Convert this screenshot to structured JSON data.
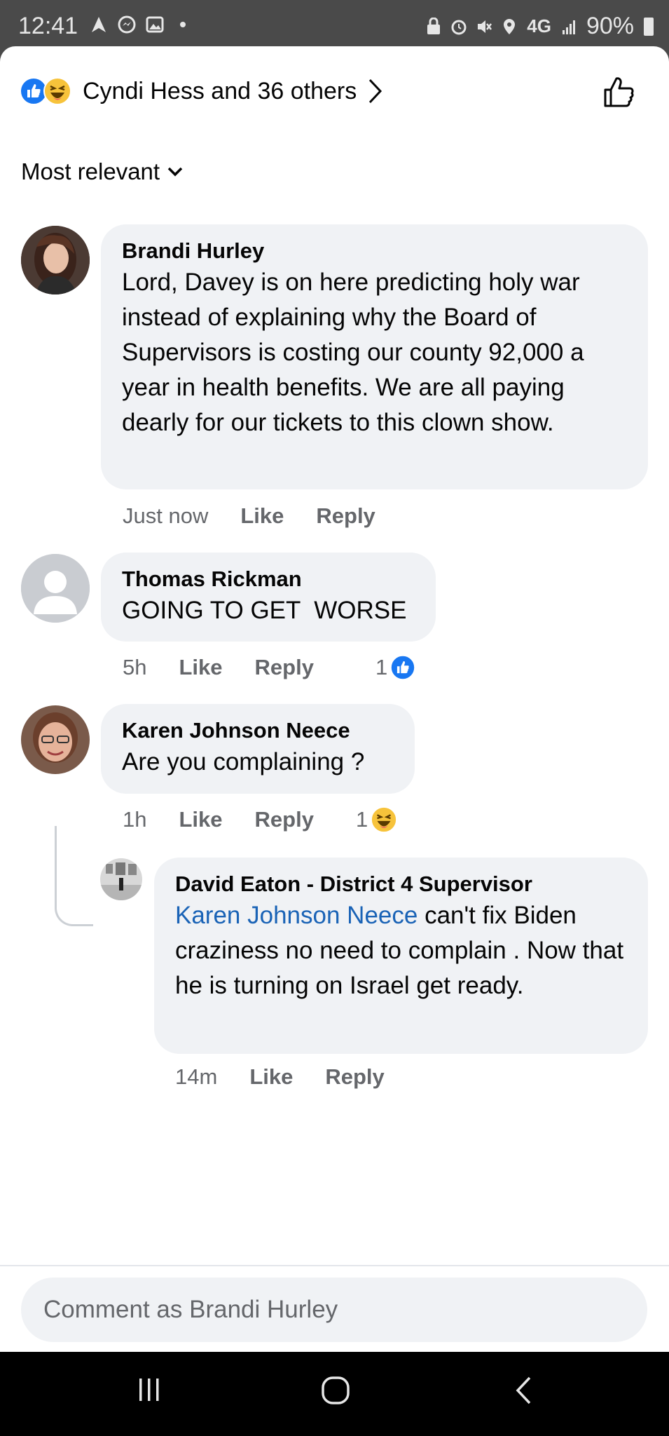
{
  "status_bar": {
    "time": "12:41",
    "network": "4G",
    "battery": "90%"
  },
  "header": {
    "reactions_text": "Cyndi Hess and 36 others"
  },
  "sort": {
    "label": "Most relevant"
  },
  "comments": [
    {
      "author": "Brandi Hurley",
      "text": "Lord, Davey is on here predicting holy war instead of explaining why the Board of Supervisors is costing our county 92,000 a year in health benefits. We are all paying dearly for our tickets to this clown show.",
      "time": "Just now",
      "like_label": "Like",
      "reply_label": "Reply"
    },
    {
      "author": "Thomas Rickman",
      "text": "GOING TO GET  WORSE",
      "time": "5h",
      "like_label": "Like",
      "reply_label": "Reply",
      "reaction_count": "1",
      "reaction_icon": "like-icon"
    },
    {
      "author": "Karen Johnson Neece",
      "text": "Are you complaining ?",
      "time": "1h",
      "like_label": "Like",
      "reply_label": "Reply",
      "reaction_count": "1",
      "reaction_icon": "haha-icon"
    },
    {
      "author": "David Eaton - District 4 Supervisor",
      "mention": "Karen Johnson Neece",
      "text": " can't fix Biden craziness no need to complain . Now that he is turning on Israel get ready.",
      "time": "14m",
      "like_label": "Like",
      "reply_label": "Reply"
    }
  ],
  "composer": {
    "placeholder": "Comment as Brandi Hurley"
  },
  "colors": {
    "facebook_blue": "#1877f2",
    "mention_blue": "#1a63b6",
    "bubble_gray": "#f0f2f5",
    "meta_gray": "#65676b",
    "haha_yellow": "#f7c33b"
  }
}
